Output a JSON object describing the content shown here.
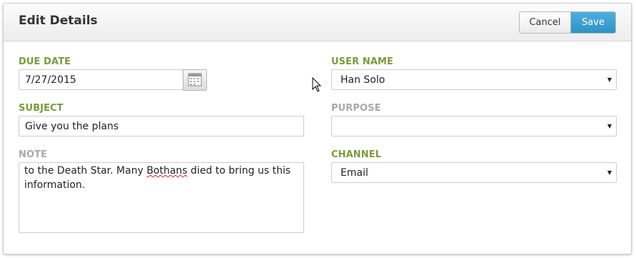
{
  "header": {
    "title": "Edit Details",
    "cancel_label": "Cancel",
    "save_label": "Save"
  },
  "colors": {
    "label_active": "#7c9a3e",
    "label_inactive": "#a8a8a8",
    "save_button": "#3aa0d2"
  },
  "fields": {
    "due_date": {
      "label": "DUE DATE",
      "value": "7/27/2015",
      "icon": "calendar-icon"
    },
    "subject": {
      "label": "SUBJECT",
      "value": "Give you the plans"
    },
    "note": {
      "label": "NOTE",
      "text_before": "to the Death Star. Many ",
      "misspelled_word": "Bothans",
      "text_after": " died to bring us this information."
    },
    "user_name": {
      "label": "USER NAME",
      "value": "Han Solo"
    },
    "purpose": {
      "label": "PURPOSE",
      "value": ""
    },
    "channel": {
      "label": "CHANNEL",
      "value": "Email"
    }
  }
}
